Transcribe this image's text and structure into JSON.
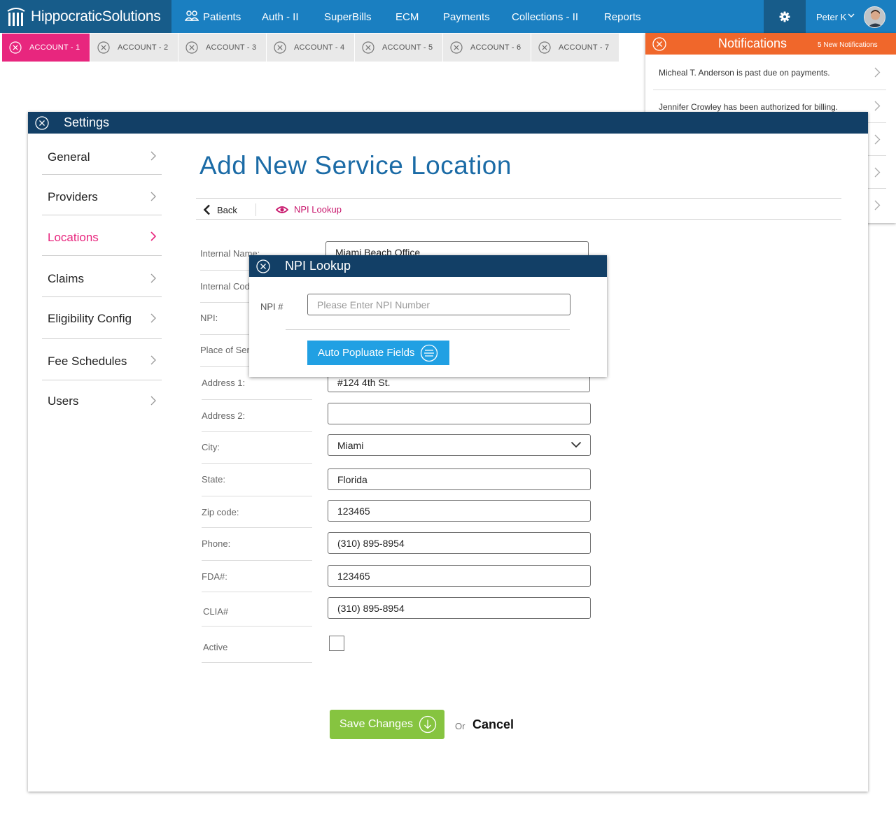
{
  "brand": {
    "part1": "Hippocratic",
    "part2": "Solutions"
  },
  "nav": {
    "items": [
      {
        "label": "Patients",
        "icon": "patients-icon"
      },
      {
        "label": "Auth - II"
      },
      {
        "label": "SuperBills"
      },
      {
        "label": "ECM"
      },
      {
        "label": "Payments"
      },
      {
        "label": "Collections - II"
      },
      {
        "label": "Reports"
      }
    ],
    "user_name": "Peter K"
  },
  "tabs": [
    "ACCOUNT - 1",
    "ACCOUNT - 2",
    "ACCOUNT - 3",
    "ACCOUNT - 4",
    "ACCOUNT - 5",
    "ACCOUNT - 6",
    "ACCOUNT - 7"
  ],
  "notifications": {
    "title": "Notifications",
    "count_label": "5 New Notifications",
    "items": [
      "Micheal T. Anderson is past due on payments.",
      "Jennifer Crowley has been authorized for billing.",
      "",
      "",
      ""
    ]
  },
  "settings": {
    "title": "Settings",
    "sidebar": [
      "General",
      "Providers",
      "Locations",
      "Claims",
      "Eligibility Config",
      "Fee Schedules",
      "Users"
    ],
    "active_item": "Locations",
    "page_title": "Add New Service Location",
    "back_label": "Back",
    "npi_link_label": "NPI Lookup",
    "fields": {
      "internal_name": {
        "label": "Internal Name:",
        "value": "Miami Beach Office"
      },
      "internal_code": {
        "label": "Internal Code:"
      },
      "npi": {
        "label": "NPI:"
      },
      "place_of_service": {
        "label": "Place of Service:"
      },
      "address1": {
        "label": "Address 1:",
        "value": "#124 4th St."
      },
      "address2": {
        "label": "Address 2:",
        "value": ""
      },
      "city": {
        "label": "City:",
        "value": "Miami"
      },
      "state": {
        "label": "State:",
        "value": "Florida"
      },
      "zip": {
        "label": "Zip code:",
        "value": "123465"
      },
      "phone": {
        "label": "Phone:",
        "value": "(310) 895-8954"
      },
      "fda": {
        "label": "FDA#:",
        "value": "123465"
      },
      "clia": {
        "label": "CLIA#",
        "value": "(310) 895-8954"
      },
      "active": {
        "label": "Active",
        "checked": false
      }
    },
    "save_label": "Save Changes",
    "or_label": "Or",
    "cancel_label": "Cancel"
  },
  "npi_lookup": {
    "title": "NPI Lookup",
    "field_label": "NPI #",
    "placeholder": "Please Enter NPI Number",
    "button_label": "Auto Popluate Fields"
  },
  "colors": {
    "nav_blue": "#1a7fc1",
    "dark_navy": "#123f66",
    "active_pink": "#e8267e",
    "notif_orange": "#f0672b",
    "save_green": "#86c440",
    "auto_blue": "#21a0e3",
    "title_blue": "#1b6ba6"
  }
}
